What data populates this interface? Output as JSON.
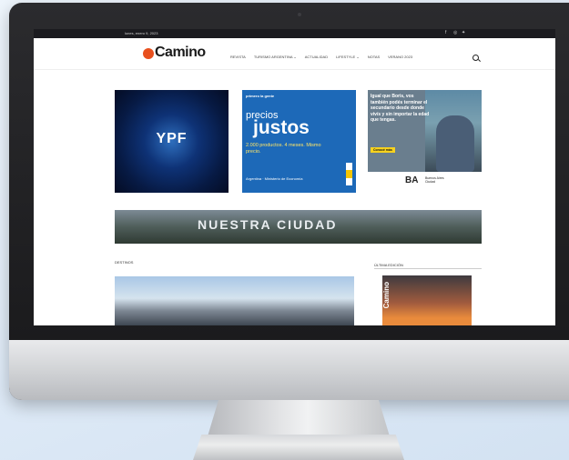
{
  "topbar": {
    "date": "lunes, enero 9, 2023",
    "social_icons": [
      "facebook-icon",
      "instagram-icon",
      "twitter-icon"
    ]
  },
  "header": {
    "logo": "Camino",
    "nav": [
      "REVISTA",
      "TURISMO ARGENTINA ⌄",
      "ACTUALIDAD",
      "LIFESTYLE ⌄",
      "NOTAS",
      "VERANO 2023"
    ]
  },
  "ads": {
    "ypf": "YPF",
    "precios": {
      "tagline": "primero la gente",
      "line1": "precios",
      "line2": "justos",
      "details": "2.000 productos. 4 meses. Mismo precio.",
      "footer": "Argentina · Ministerio de Economía"
    },
    "ba": {
      "text": "Igual que Boris, vos también podés terminar el secundario desde donde vivís y sin importar la edad que tengas.",
      "button": "Conocé más",
      "logo": "BA",
      "logo_sub": "Buenos Aires Ciudad"
    },
    "city": "NUESTRA CIUDAD"
  },
  "sections": {
    "destinos": "DESTINOS",
    "ultima": "ÚLTIMA EDICIÓN"
  },
  "magazine": {
    "title": "Camino"
  }
}
